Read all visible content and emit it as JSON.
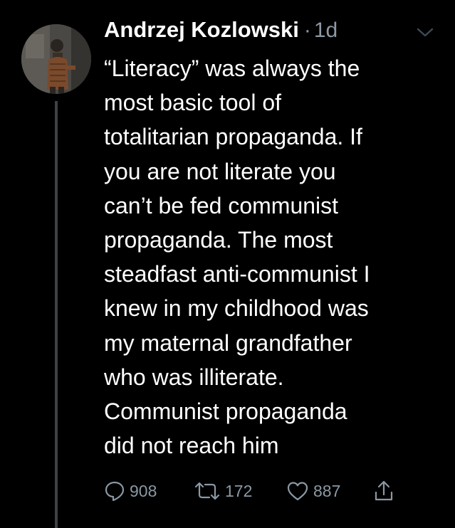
{
  "tweet": {
    "author_name": "Andrzej Kozlowski",
    "separator": "·",
    "time": "1d",
    "text_lines": [
      "“Literacy” was always the",
      "most basic tool of",
      "totalitarian propaganda. If",
      "you are not literate you",
      "can’t be fed communist",
      "propaganda. The most",
      "steadfast anti-communist I",
      "knew in my childhood was",
      "my maternal grandfather",
      "who was illiterate.",
      "Communist propaganda",
      "did not reach him"
    ],
    "actions": {
      "replies": "908",
      "retweets": "172",
      "likes": "887"
    }
  },
  "icons": {
    "reply": "reply-icon",
    "retweet": "retweet-icon",
    "like": "heart-icon",
    "share": "share-icon",
    "menu": "chevron-down-icon"
  },
  "colors": {
    "background": "#000000",
    "text": "#ffffff",
    "muted": "#8b98a5",
    "thread_line": "#3d4246"
  }
}
